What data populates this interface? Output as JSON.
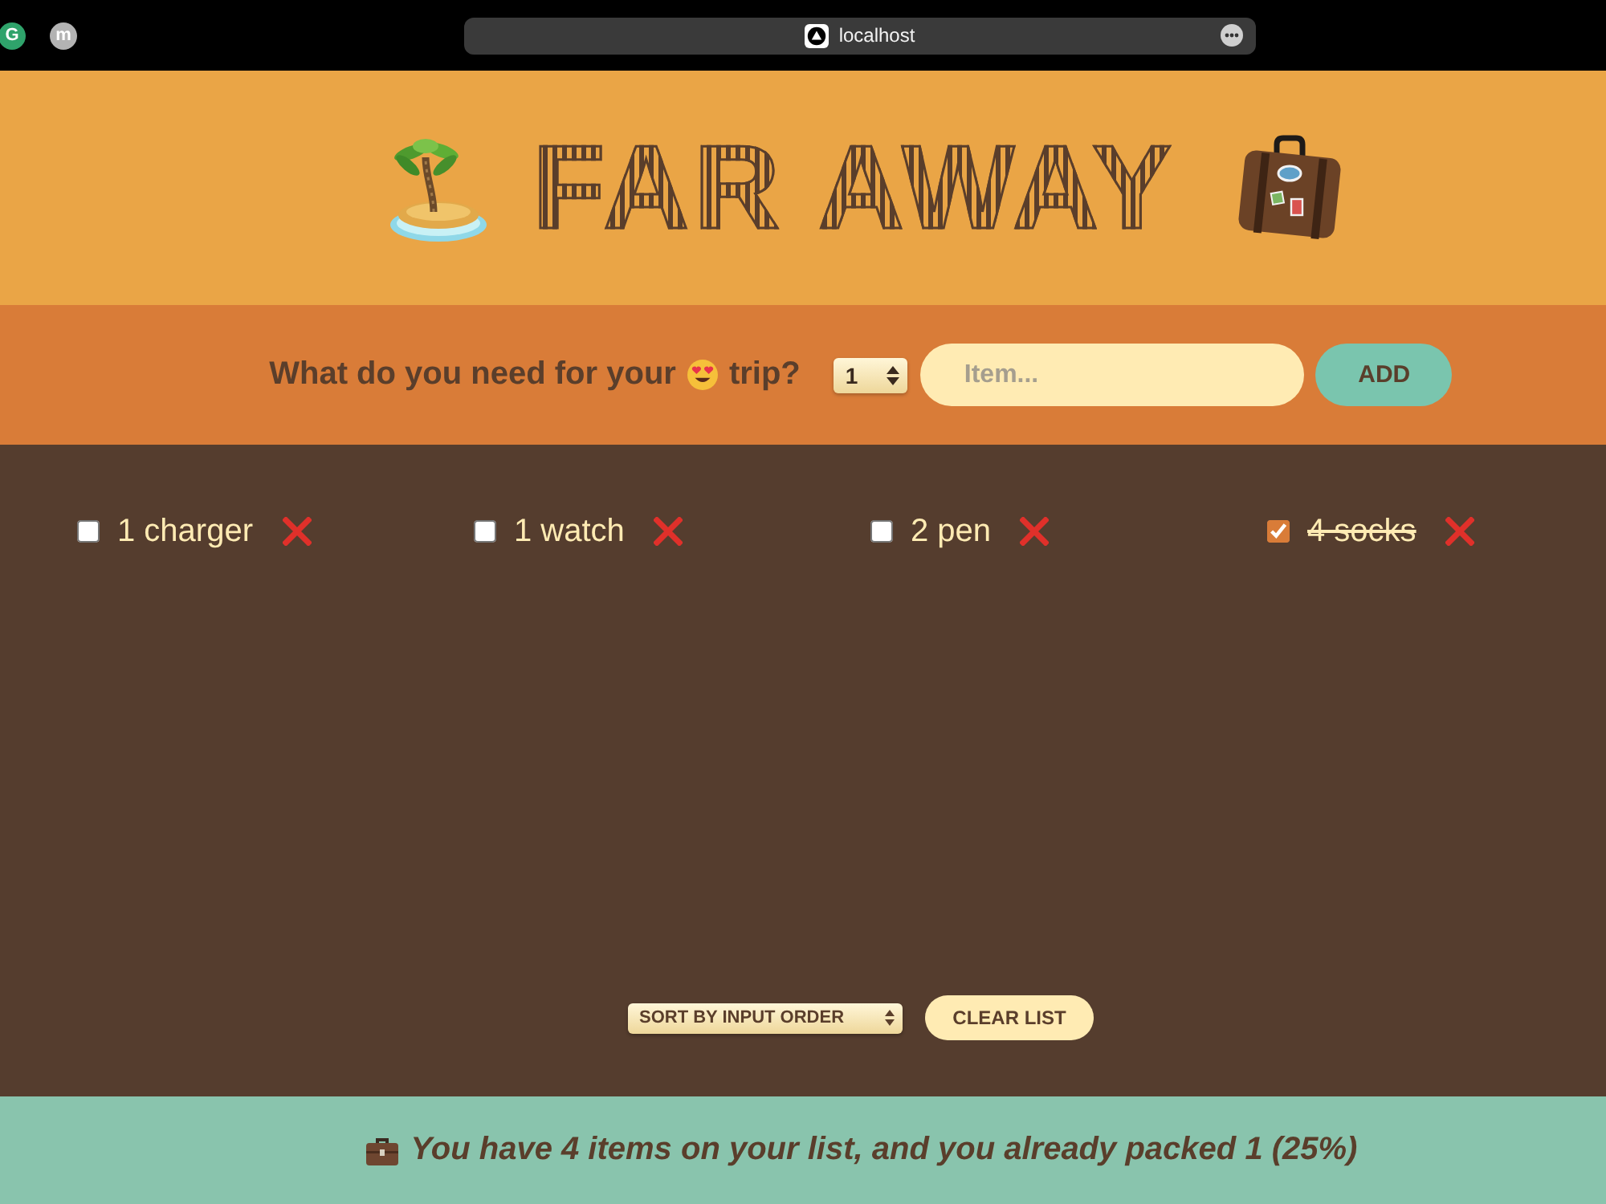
{
  "browser": {
    "extensions": [
      {
        "letter": "G",
        "color": "#2fa36b"
      },
      {
        "letter": "m",
        "color": "#b3b3b3"
      }
    ],
    "address": "localhost"
  },
  "header": {
    "title": "FAR AWAY"
  },
  "form": {
    "question_start": "What do you need for your",
    "question_end": "trip?",
    "quantity": "1",
    "item_field": {
      "placeholder": "Item..."
    },
    "add_button": "ADD"
  },
  "items": [
    {
      "text": "1 charger",
      "checked": false
    },
    {
      "text": "1 watch",
      "checked": false
    },
    {
      "text": "2 pen",
      "checked": false
    },
    {
      "text": "4 socks",
      "checked": true
    }
  ],
  "actions": {
    "sort_select": "SORT BY INPUT ORDER",
    "clear_button": "CLEAR LIST"
  },
  "stats": {
    "text": "You have 4 items on your list, and you already packed 1 (25%)"
  }
}
